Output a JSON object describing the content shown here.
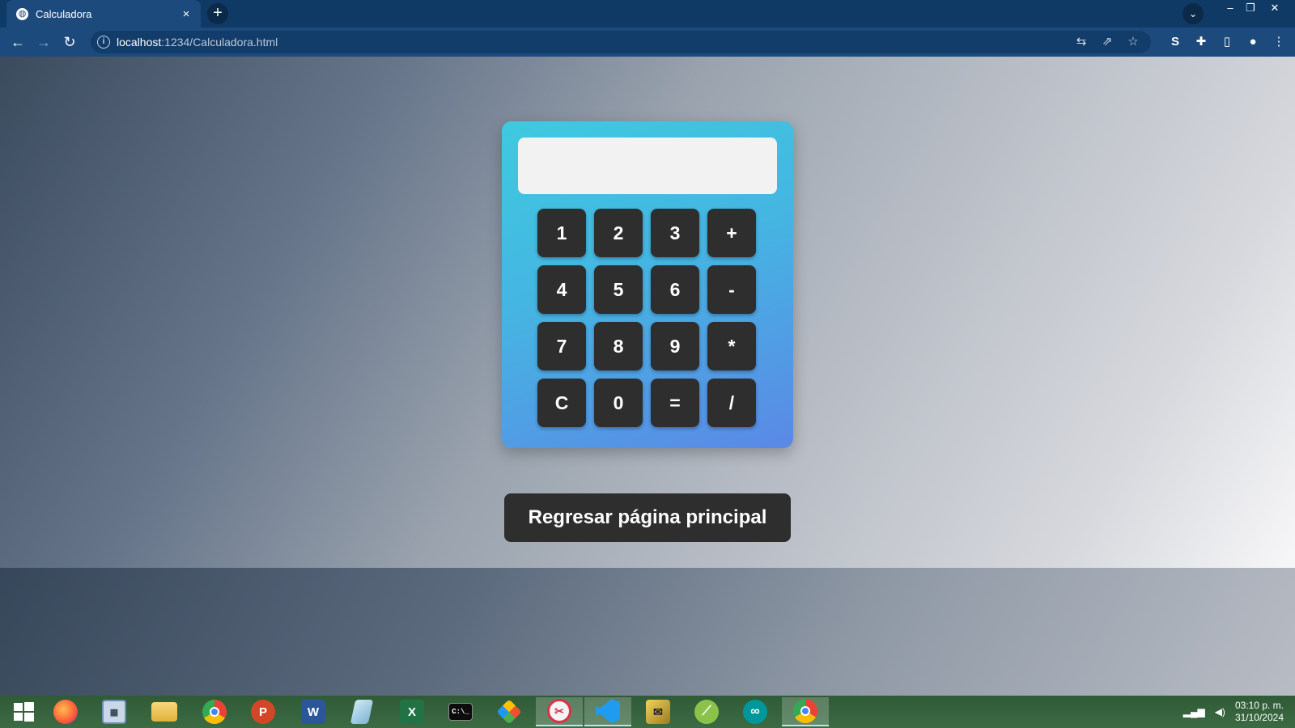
{
  "browser": {
    "tab_title": "Calculadora",
    "tab_close": "×",
    "new_tab": "+",
    "url_host": "localhost",
    "url_path": ":1234/Calculadora.html"
  },
  "window_controls": {
    "minimize": "–",
    "restore": "❐",
    "close": "✕"
  },
  "calculator": {
    "display_value": "",
    "keys": [
      [
        "1",
        "2",
        "3",
        "+"
      ],
      [
        "4",
        "5",
        "6",
        "-"
      ],
      [
        "7",
        "8",
        "9",
        "*"
      ],
      [
        "C",
        "0",
        "=",
        "/"
      ]
    ]
  },
  "back_button_label": "Regresar página principal",
  "taskbar": {
    "apps": [
      "windows-start",
      "firefox",
      "calculator",
      "file-explorer",
      "chrome",
      "powerpoint",
      "word",
      "notepad",
      "excel",
      "command-prompt",
      "git",
      "snipping-tool",
      "vscode",
      "archive-tool",
      "android-studio",
      "arduino",
      "chrome-profile"
    ],
    "clock_time": "03:10 p. m.",
    "clock_date": "31/10/2024"
  },
  "colors": {
    "calc_gradient_start": "#3ecadf",
    "calc_gradient_end": "#5b88e6",
    "key_bg": "#2e2e2e",
    "browser_frame": "#1d4a7c"
  }
}
